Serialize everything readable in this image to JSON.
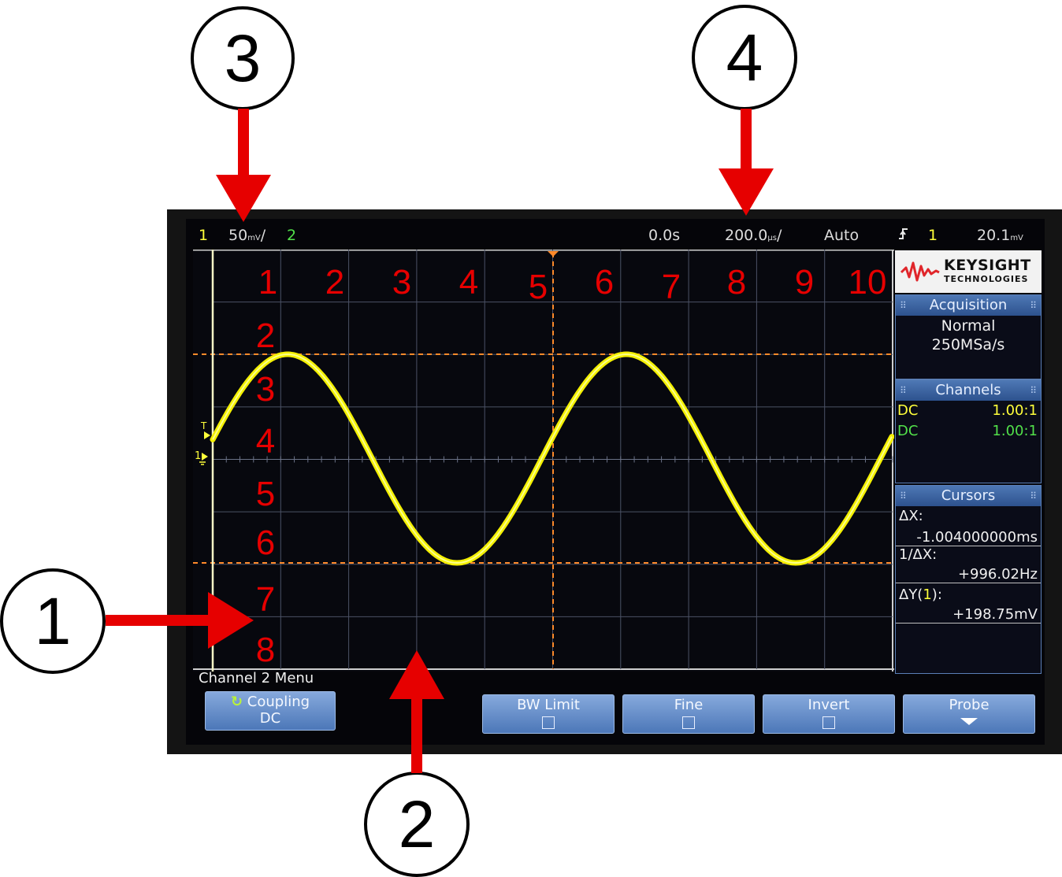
{
  "callouts": {
    "one": "1",
    "two": "2",
    "three": "3",
    "four": "4"
  },
  "status_bar": {
    "channel1": "1",
    "volts_per_div": "50",
    "volts_unit_glyph": "mV",
    "volts_per_div_suffix": "/",
    "channel2": "2",
    "time_delay": "0.0s",
    "time_per_div": "200.0",
    "time_unit_glyph": "µs",
    "time_per_div_suffix": "/",
    "trigger_mode": "Auto",
    "trigger_slope_icon": "rising-edge-icon",
    "trigger_source": "1",
    "trigger_level": "20.1",
    "trigger_level_unit": "mV"
  },
  "grid_labels": {
    "columns": [
      "1",
      "2",
      "3",
      "4",
      "5",
      "6",
      "7",
      "8",
      "9",
      "10"
    ],
    "rows": [
      "2",
      "3",
      "4",
      "5",
      "6",
      "7",
      "8"
    ]
  },
  "markers": {
    "trigger_marker": "T",
    "channel1_ground": "1"
  },
  "waveform": {
    "type": "sine",
    "color": "#f4f000",
    "frequency_hz": 996.02,
    "peak_to_peak_mv": 198.75
  },
  "colors": {
    "trace": "#f4f000",
    "cursor": "#ff8a2a",
    "grid": "#525a6e",
    "label": "#e60000",
    "arrow": "#e60000",
    "softkey": "#5f86c4"
  },
  "side_panel": {
    "logo_brand": "KEYSIGHT",
    "logo_sub": "TECHNOLOGIES",
    "logo_icon": "waveform-logo-icon",
    "acquisition": {
      "title": "Acquisition",
      "mode": "Normal",
      "rate": "250MSa/s"
    },
    "channels": {
      "title": "Channels",
      "rows": [
        {
          "coupling": "DC",
          "probe": "1.00:1",
          "color": "#ffff3a"
        },
        {
          "coupling": "DC",
          "probe": "1.00:1",
          "color": "#52e04a"
        }
      ]
    },
    "cursors": {
      "title": "Cursors",
      "dx_label": "ΔX:",
      "dx_value": "-1.004000000ms",
      "inv_dx_label": "1/ΔX:",
      "inv_dx_value": "+996.02Hz",
      "dy_label_prefix": "ΔY(",
      "dy_label_channel": "1",
      "dy_label_suffix": "):",
      "dy_value": "+198.75mV"
    }
  },
  "softkeys": {
    "menu_title": "Channel 2 Menu",
    "coupling": {
      "label": "Coupling",
      "value": "DC",
      "icon": "rotate-arrow-icon"
    },
    "bw_limit": {
      "label": "BW Limit"
    },
    "fine": {
      "label": "Fine"
    },
    "invert": {
      "label": "Invert"
    },
    "probe": {
      "label": "Probe",
      "icon": "down-arrow-icon"
    }
  }
}
